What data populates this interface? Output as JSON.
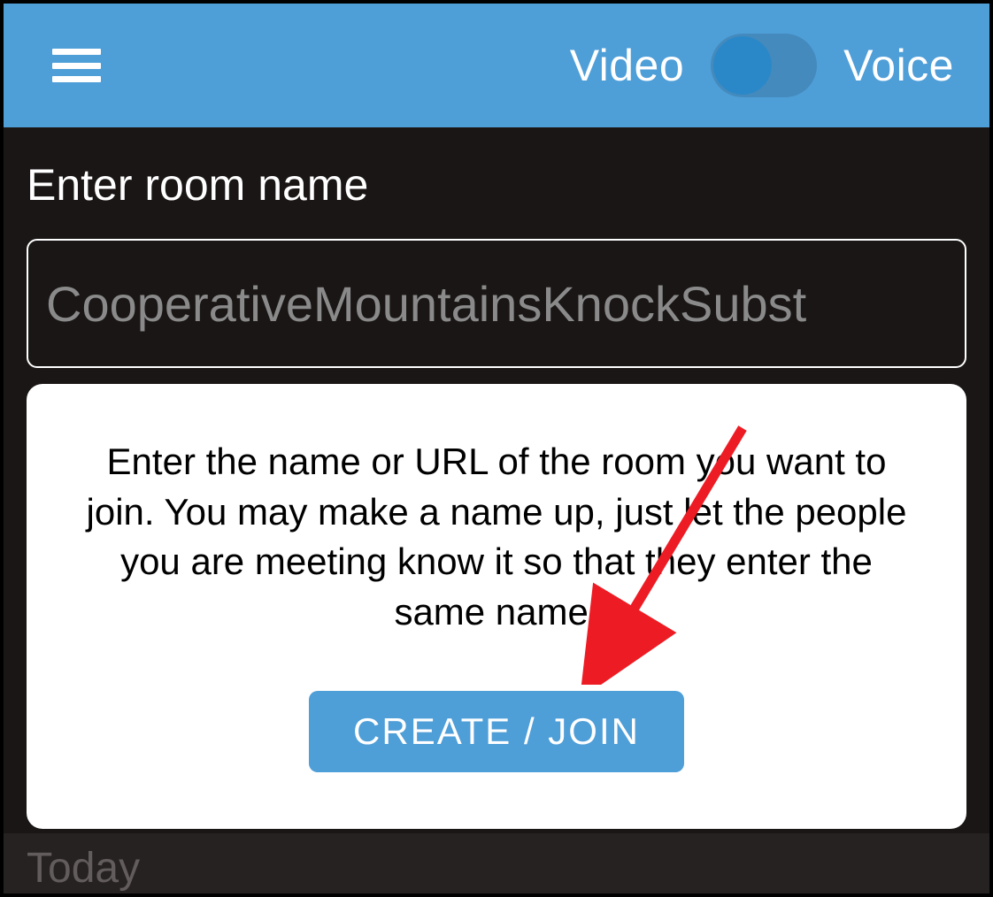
{
  "header": {
    "mode_left": "Video",
    "mode_right": "Voice"
  },
  "form": {
    "label": "Enter room name",
    "room_placeholder": "CooperativeMountainsKnockSubst"
  },
  "card": {
    "help_text": "Enter the name or URL of the room you want to join. You may make a name up, just let the people you are meeting know it so that they enter the same name.",
    "button_label": "CREATE / JOIN"
  },
  "footer": {
    "label": "Today"
  },
  "colors": {
    "header_bg": "#4e9ed8",
    "body_bg": "#1b1616",
    "accent": "#4e9ed8",
    "arrow": "#ed1c24"
  }
}
